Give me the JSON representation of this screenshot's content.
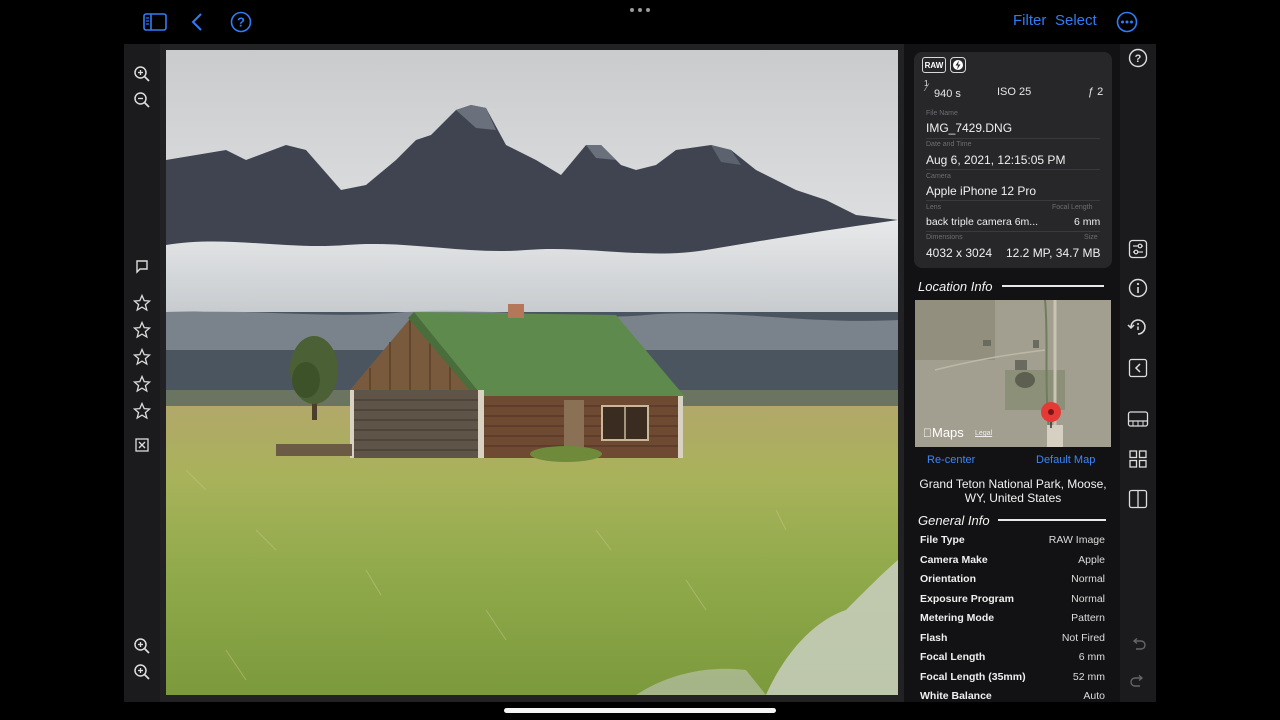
{
  "toolbar": {
    "sidebar_icon": "sidebar-icon",
    "back_icon": "chevron-left-icon",
    "help_icon": "question-circle-icon",
    "filter_label": "Filter",
    "select_label": "Select",
    "more_icon": "ellipsis-circle-icon",
    "accent_color": "#2f7df6"
  },
  "left_rail": {
    "top_icons": [
      "zoom-in-icon",
      "zoom-out-icon"
    ],
    "middle_icons": [
      "flag-icon",
      "star-icon",
      "star-icon",
      "star-icon",
      "star-icon",
      "star-icon",
      "reject-icon"
    ],
    "bottom_icons": [
      "zoom-fit-icon",
      "zoom-actual-icon"
    ]
  },
  "exif": {
    "badges": [
      "RAW",
      "⚡"
    ],
    "shutter_numerator": "1",
    "shutter_denominator": "940 s",
    "iso": "ISO 25",
    "aperture": "ƒ 2",
    "file_name_label": "File Name",
    "file_name": "IMG_7429.DNG",
    "datetime_label": "Date and Time",
    "datetime": "Aug 6, 2021, 12:15:05 PM",
    "camera_label": "Camera",
    "camera": "Apple iPhone 12 Pro",
    "lens_label": "Lens",
    "lens": "back triple camera 6m...",
    "focal_label": "Focal Length",
    "focal": "6 mm",
    "dimensions_label": "Dimensions",
    "dimensions": "4032 x 3024",
    "size_label": "Size",
    "size": "12.2 MP, 34.7 MB"
  },
  "location": {
    "title": "Location Info",
    "maps_brand": "Maps",
    "legal": "Legal",
    "recenter_label": "Re-center",
    "default_map_label": "Default Map",
    "address": "Grand Teton National Park, Moose, WY, United States"
  },
  "general": {
    "title": "General Info",
    "rows": [
      {
        "key": "File Type",
        "value": "RAW Image"
      },
      {
        "key": "Camera Make",
        "value": "Apple"
      },
      {
        "key": "Orientation",
        "value": "Normal"
      },
      {
        "key": "Exposure Program",
        "value": "Normal"
      },
      {
        "key": "Metering Mode",
        "value": "Pattern"
      },
      {
        "key": "Flash",
        "value": "Not Fired"
      },
      {
        "key": "Focal Length",
        "value": "6 mm"
      },
      {
        "key": "Focal Length (35mm)",
        "value": "52 mm"
      },
      {
        "key": "White Balance",
        "value": "Auto"
      }
    ]
  },
  "right_rail": {
    "top_icons": [
      "help-circle-icon"
    ],
    "middle_icons": [
      "adjustments-icon",
      "info-circle-icon",
      "rotate-icon",
      "collapse-panel-icon",
      "filmstrip-icon",
      "grid-icon",
      "split-view-icon"
    ],
    "bottom_icons": [
      "undo-icon",
      "redo-icon"
    ]
  }
}
